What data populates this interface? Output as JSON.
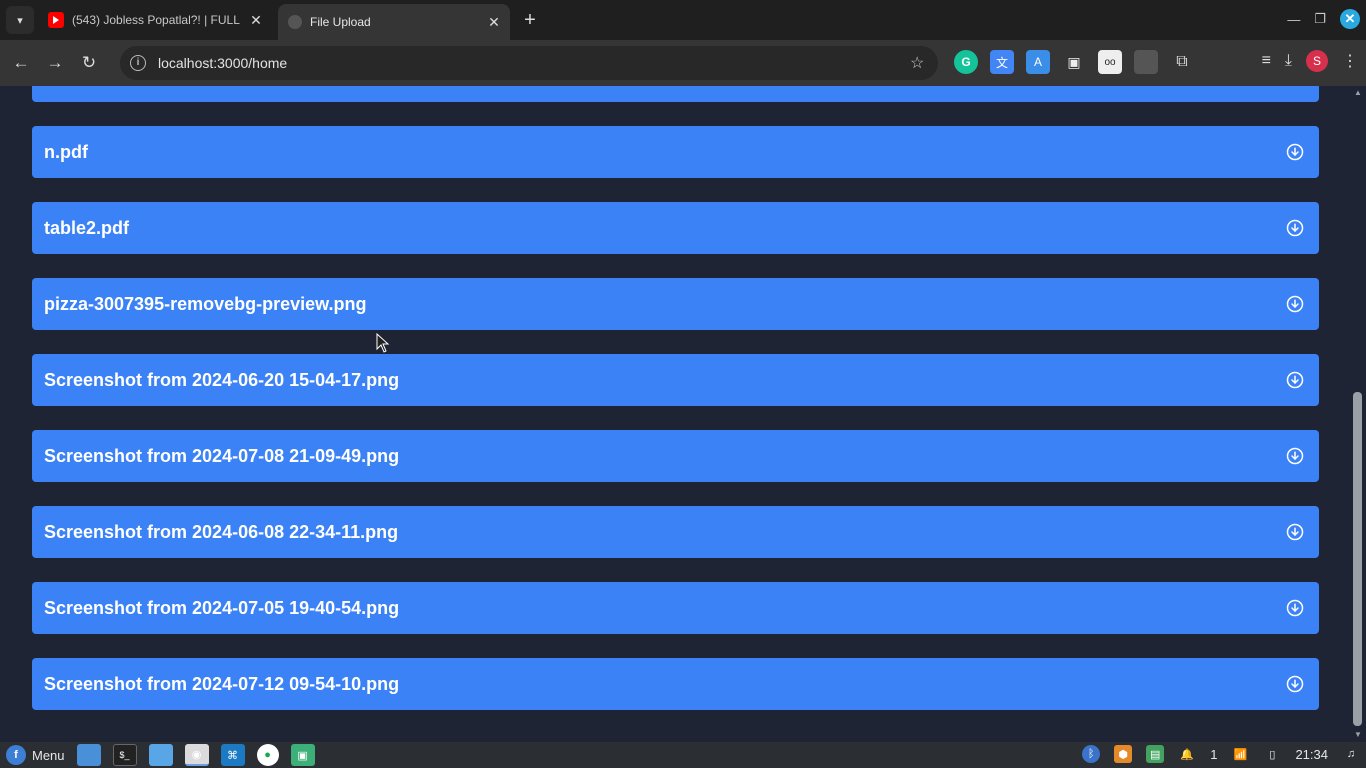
{
  "browser": {
    "tabs": [
      {
        "title": "(543) Jobless Popatlal?! | FULL",
        "active": false
      },
      {
        "title": "File Upload",
        "active": true
      }
    ],
    "url": "localhost:3000/home",
    "profile_initial": "S"
  },
  "files": [
    {
      "name": "n.pdf"
    },
    {
      "name": "table2.pdf"
    },
    {
      "name": "pizza-3007395-removebg-preview.png"
    },
    {
      "name": "Screenshot from 2024-06-20 15-04-17.png"
    },
    {
      "name": "Screenshot from 2024-07-08 21-09-49.png"
    },
    {
      "name": "Screenshot from 2024-06-08 22-34-11.png"
    },
    {
      "name": "Screenshot from 2024-07-05 19-40-54.png"
    },
    {
      "name": "Screenshot from 2024-07-12 09-54-10.png"
    }
  ],
  "taskbar": {
    "menu_label": "Menu",
    "notification_count": "1",
    "clock": "21:34"
  },
  "colors": {
    "row_background": "#3b82f6",
    "page_background": "#1e2433"
  }
}
